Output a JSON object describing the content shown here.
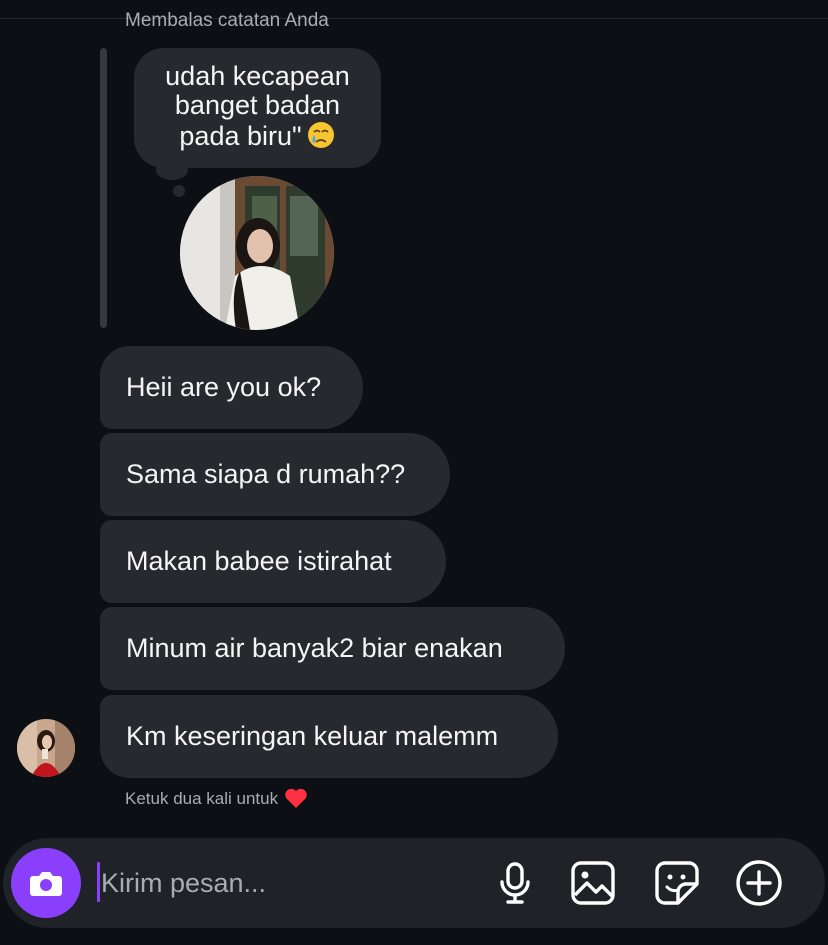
{
  "reply": {
    "label": "Membalas catatan Anda",
    "note_text": "udah kecapean banget badan pada biru\""
  },
  "messages": [
    {
      "text": "Heii are you ok?"
    },
    {
      "text": "Sama siapa d rumah??"
    },
    {
      "text": "Makan babee istirahat"
    },
    {
      "text": "Minum air banyak2 biar enakan"
    },
    {
      "text": "Km keseringan keluar malemm"
    }
  ],
  "hint": {
    "text": "Ketuk dua kali untuk",
    "icon": "heart-icon"
  },
  "composer": {
    "placeholder": "Kirim pesan...",
    "icons": [
      "camera-icon",
      "microphone-icon",
      "gallery-icon",
      "sticker-icon",
      "plus-icon"
    ]
  },
  "colors": {
    "background": "#0c1014",
    "bubble": "#26292e",
    "accent": "#8a3ffc",
    "muted_text": "#a8adb3",
    "heart": "#ff3040"
  }
}
